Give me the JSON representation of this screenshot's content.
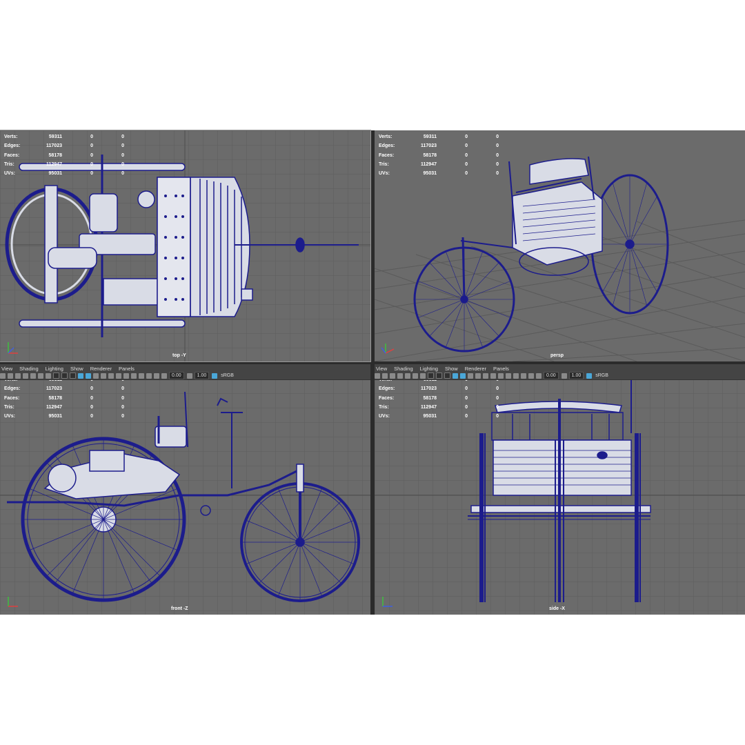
{
  "stats_labels": [
    "Verts:",
    "Edges:",
    "Faces:",
    "Tris:",
    "UVs:"
  ],
  "stats_values": [
    [
      "59311",
      "0",
      "0"
    ],
    [
      "117023",
      "0",
      "0"
    ],
    [
      "58178",
      "0",
      "0"
    ],
    [
      "112947",
      "0",
      "0"
    ],
    [
      "95031",
      "0",
      "0"
    ]
  ],
  "menu": [
    "View",
    "Shading",
    "Lighting",
    "Show",
    "Renderer",
    "Panels"
  ],
  "toolbar": {
    "exposure": "0.00",
    "gamma": "1.00",
    "colorspace": "sRGB"
  },
  "cameras": {
    "top": "top -Y",
    "persp": "persp",
    "front": "front -Z",
    "side": "side -X"
  },
  "colors": {
    "wire": "#1c1c8c",
    "viewport_bg": "#6b6b6b",
    "grid": "#5e5e5e",
    "model_fill": "#d9dce6"
  },
  "icons": [
    "select-tool-icon",
    "camera-icon",
    "grid-icon",
    "wireframe-icon",
    "shaded-icon",
    "light-icon",
    "isolate-icon",
    "color-management-icon"
  ]
}
